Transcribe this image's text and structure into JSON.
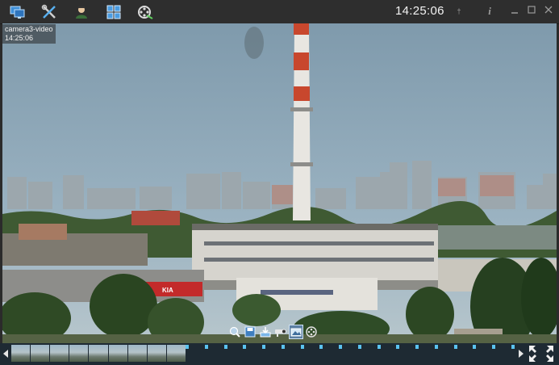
{
  "toolbar": {
    "icons": [
      "monitors-icon",
      "settings-tools-icon",
      "user-icon",
      "layout-grid-icon",
      "video-film-icon"
    ],
    "clock": "14:25:06",
    "pin_icon": "pin-icon",
    "info_icon": "info-icon",
    "window_controls": [
      "minimize-icon",
      "maximize-icon",
      "close-icon"
    ]
  },
  "video": {
    "camera_name": "camera3-video",
    "timestamp": "14:25:06",
    "signage": "KIA"
  },
  "controls": {
    "buttons": [
      "zoom-icon",
      "save-icon",
      "export-icon",
      "ptz-camera-icon",
      "snapshot-icon",
      "film-reel-icon"
    ],
    "active_index": 4
  },
  "timeline": {
    "thumbnail_count": 9,
    "tick_count": 18
  },
  "colors": {
    "accent": "#5ac3f0",
    "toolbar_bg": "#2e2e2e",
    "chimney_red": "#c8472d"
  }
}
